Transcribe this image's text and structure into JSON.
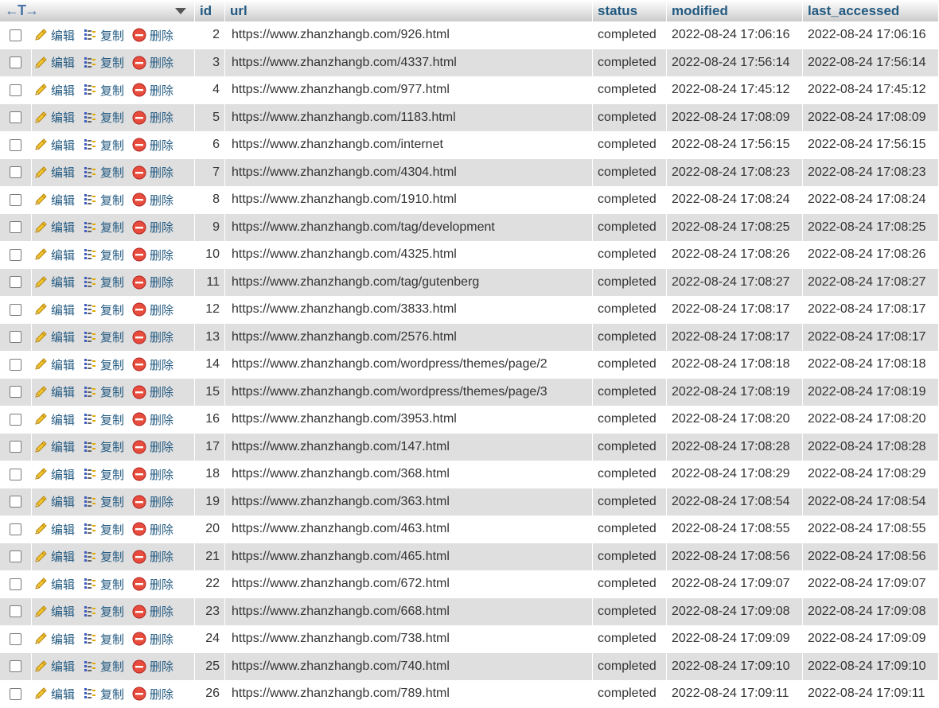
{
  "header": {
    "arrows": "←T→",
    "columns": [
      "id",
      "url",
      "status",
      "modified",
      "last_accessed"
    ]
  },
  "actions": {
    "edit": "编辑",
    "copy": "复制",
    "delete": "删除"
  },
  "rows": [
    {
      "id": "2",
      "url": "https://www.zhanzhangb.com/926.html",
      "status": "completed",
      "modified": "2022-08-24 17:06:16",
      "last_accessed": "2022-08-24 17:06:16"
    },
    {
      "id": "3",
      "url": "https://www.zhanzhangb.com/4337.html",
      "status": "completed",
      "modified": "2022-08-24 17:56:14",
      "last_accessed": "2022-08-24 17:56:14"
    },
    {
      "id": "4",
      "url": "https://www.zhanzhangb.com/977.html",
      "status": "completed",
      "modified": "2022-08-24 17:45:12",
      "last_accessed": "2022-08-24 17:45:12"
    },
    {
      "id": "5",
      "url": "https://www.zhanzhangb.com/1183.html",
      "status": "completed",
      "modified": "2022-08-24 17:08:09",
      "last_accessed": "2022-08-24 17:08:09"
    },
    {
      "id": "6",
      "url": "https://www.zhanzhangb.com/internet",
      "status": "completed",
      "modified": "2022-08-24 17:56:15",
      "last_accessed": "2022-08-24 17:56:15"
    },
    {
      "id": "7",
      "url": "https://www.zhanzhangb.com/4304.html",
      "status": "completed",
      "modified": "2022-08-24 17:08:23",
      "last_accessed": "2022-08-24 17:08:23"
    },
    {
      "id": "8",
      "url": "https://www.zhanzhangb.com/1910.html",
      "status": "completed",
      "modified": "2022-08-24 17:08:24",
      "last_accessed": "2022-08-24 17:08:24"
    },
    {
      "id": "9",
      "url": "https://www.zhanzhangb.com/tag/development",
      "status": "completed",
      "modified": "2022-08-24 17:08:25",
      "last_accessed": "2022-08-24 17:08:25"
    },
    {
      "id": "10",
      "url": "https://www.zhanzhangb.com/4325.html",
      "status": "completed",
      "modified": "2022-08-24 17:08:26",
      "last_accessed": "2022-08-24 17:08:26"
    },
    {
      "id": "11",
      "url": "https://www.zhanzhangb.com/tag/gutenberg",
      "status": "completed",
      "modified": "2022-08-24 17:08:27",
      "last_accessed": "2022-08-24 17:08:27"
    },
    {
      "id": "12",
      "url": "https://www.zhanzhangb.com/3833.html",
      "status": "completed",
      "modified": "2022-08-24 17:08:17",
      "last_accessed": "2022-08-24 17:08:17"
    },
    {
      "id": "13",
      "url": "https://www.zhanzhangb.com/2576.html",
      "status": "completed",
      "modified": "2022-08-24 17:08:17",
      "last_accessed": "2022-08-24 17:08:17"
    },
    {
      "id": "14",
      "url": "https://www.zhanzhangb.com/wordpress/themes/page/2",
      "status": "completed",
      "modified": "2022-08-24 17:08:18",
      "last_accessed": "2022-08-24 17:08:18"
    },
    {
      "id": "15",
      "url": "https://www.zhanzhangb.com/wordpress/themes/page/3",
      "status": "completed",
      "modified": "2022-08-24 17:08:19",
      "last_accessed": "2022-08-24 17:08:19"
    },
    {
      "id": "16",
      "url": "https://www.zhanzhangb.com/3953.html",
      "status": "completed",
      "modified": "2022-08-24 17:08:20",
      "last_accessed": "2022-08-24 17:08:20"
    },
    {
      "id": "17",
      "url": "https://www.zhanzhangb.com/147.html",
      "status": "completed",
      "modified": "2022-08-24 17:08:28",
      "last_accessed": "2022-08-24 17:08:28"
    },
    {
      "id": "18",
      "url": "https://www.zhanzhangb.com/368.html",
      "status": "completed",
      "modified": "2022-08-24 17:08:29",
      "last_accessed": "2022-08-24 17:08:29"
    },
    {
      "id": "19",
      "url": "https://www.zhanzhangb.com/363.html",
      "status": "completed",
      "modified": "2022-08-24 17:08:54",
      "last_accessed": "2022-08-24 17:08:54"
    },
    {
      "id": "20",
      "url": "https://www.zhanzhangb.com/463.html",
      "status": "completed",
      "modified": "2022-08-24 17:08:55",
      "last_accessed": "2022-08-24 17:08:55"
    },
    {
      "id": "21",
      "url": "https://www.zhanzhangb.com/465.html",
      "status": "completed",
      "modified": "2022-08-24 17:08:56",
      "last_accessed": "2022-08-24 17:08:56"
    },
    {
      "id": "22",
      "url": "https://www.zhanzhangb.com/672.html",
      "status": "completed",
      "modified": "2022-08-24 17:09:07",
      "last_accessed": "2022-08-24 17:09:07"
    },
    {
      "id": "23",
      "url": "https://www.zhanzhangb.com/668.html",
      "status": "completed",
      "modified": "2022-08-24 17:09:08",
      "last_accessed": "2022-08-24 17:09:08"
    },
    {
      "id": "24",
      "url": "https://www.zhanzhangb.com/738.html",
      "status": "completed",
      "modified": "2022-08-24 17:09:09",
      "last_accessed": "2022-08-24 17:09:09"
    },
    {
      "id": "25",
      "url": "https://www.zhanzhangb.com/740.html",
      "status": "completed",
      "modified": "2022-08-24 17:09:10",
      "last_accessed": "2022-08-24 17:09:10"
    },
    {
      "id": "26",
      "url": "https://www.zhanzhangb.com/789.html",
      "status": "completed",
      "modified": "2022-08-24 17:09:11",
      "last_accessed": "2022-08-24 17:09:11"
    }
  ]
}
